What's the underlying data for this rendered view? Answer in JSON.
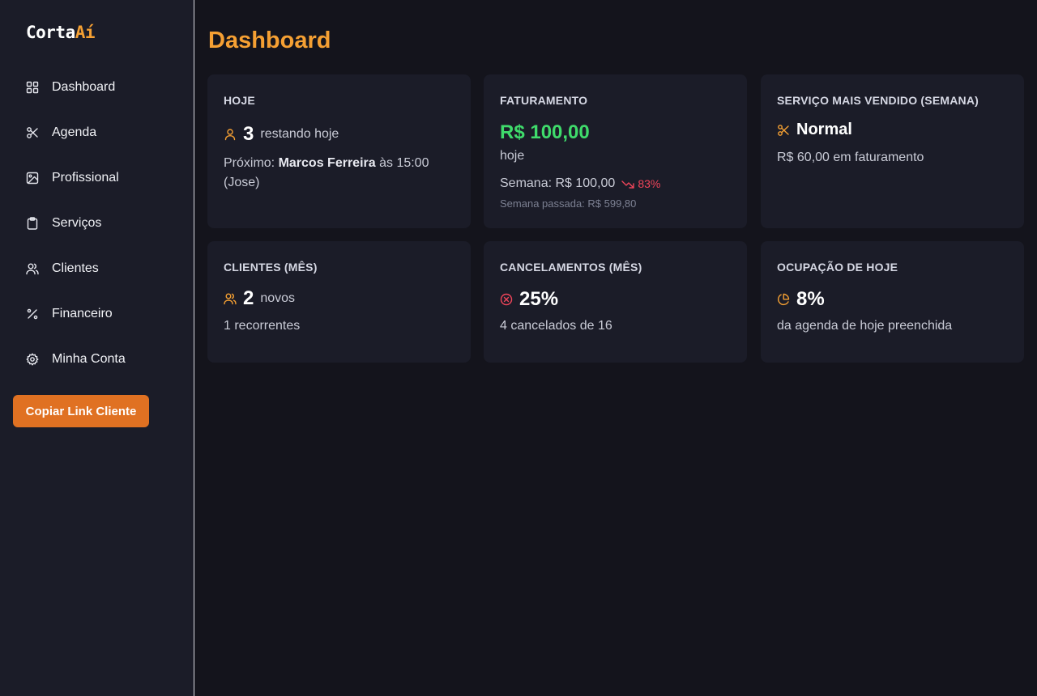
{
  "app": {
    "logo_main": "Corta",
    "logo_accent": "Aí",
    "accent_color": "#f5a033",
    "button_color": "#e07122"
  },
  "sidebar": {
    "items": [
      {
        "label": "Dashboard",
        "icon": "grid-icon"
      },
      {
        "label": "Agenda",
        "icon": "scissors-icon"
      },
      {
        "label": "Profissional",
        "icon": "image-icon"
      },
      {
        "label": "Serviços",
        "icon": "clipboard-icon"
      },
      {
        "label": "Clientes",
        "icon": "users-icon"
      },
      {
        "label": "Financeiro",
        "icon": "percent-icon"
      },
      {
        "label": "Minha Conta",
        "icon": "gear-icon"
      }
    ],
    "copy_button": "Copiar Link Cliente"
  },
  "main": {
    "title": "Dashboard",
    "cards": {
      "today": {
        "title": "HOJE",
        "count": "3",
        "count_label": "restando hoje",
        "next_prefix": "Próximo:",
        "next_name": "Marcos Ferreira",
        "next_time": "às 15:00",
        "next_pro": "(Jose)"
      },
      "revenue": {
        "title": "FATURAMENTO",
        "amount": "R$ 100,00",
        "amount_label": "hoje",
        "week": "Semana: R$ 100,00",
        "trend": "83%",
        "last_week": "Semana passada: R$ 599,80"
      },
      "top_service": {
        "title": "SERVIÇO MAIS VENDIDO (SEMANA)",
        "name": "Normal",
        "revenue": "R$ 60,00 em faturamento"
      },
      "clients": {
        "title": "CLIENTES (MÊS)",
        "new_count": "2",
        "new_label": "novos",
        "recurring": "1 recorrentes"
      },
      "cancellations": {
        "title": "CANCELAMENTOS (MÊS)",
        "percent": "25%",
        "detail": "4 cancelados de 16"
      },
      "occupancy": {
        "title": "OCUPAÇÃO DE HOJE",
        "percent": "8%",
        "detail": "da agenda de hoje preenchida"
      }
    }
  }
}
